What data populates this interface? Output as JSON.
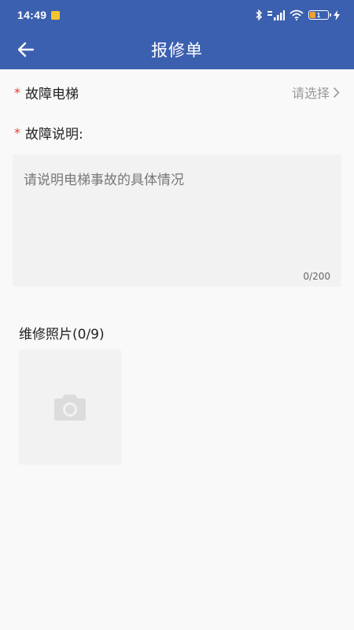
{
  "status_bar": {
    "time": "14:49",
    "battery_level": "1",
    "icons": [
      "notification-icon",
      "bluetooth-icon",
      "signal-icon",
      "wifi-icon",
      "battery-icon",
      "charging-icon"
    ]
  },
  "navbar": {
    "title": "报修单",
    "back_icon": "arrow-left-icon"
  },
  "form": {
    "elevator": {
      "required_mark": "*",
      "label": "故障电梯",
      "picker_text": "请选择"
    },
    "description": {
      "required_mark": "*",
      "label": "故障说明:",
      "placeholder": "请说明电梯事故的具体情况",
      "value": "",
      "counter": "0/200"
    },
    "photos": {
      "label": "维修照片(0/9)",
      "add_icon": "camera-icon"
    }
  },
  "colors": {
    "header_bg": "#3c60b0",
    "required": "#e53935",
    "page_bg": "#f9f9f9",
    "field_bg": "#f2f2f2"
  }
}
